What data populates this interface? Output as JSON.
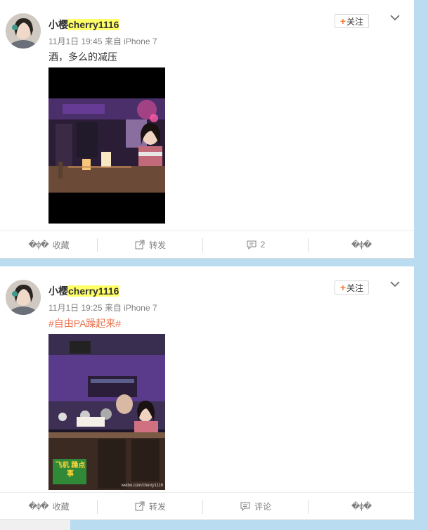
{
  "posts": [
    {
      "user": {
        "name_prefix": "小樱",
        "name_highlight": "cherry1116"
      },
      "meta": "11月1日 19:45 来自 iPhone 7",
      "text": "酒，多么的减压",
      "follow_label": "关注",
      "follow_plus": "+",
      "actions": {
        "fav_glyphs": "�ϕ�",
        "fav_label": "收藏",
        "repost_label": "转发",
        "comment_label": "2",
        "like_glyphs": "�ϕ�"
      }
    },
    {
      "user": {
        "name_prefix": "小樱",
        "name_highlight": "cherry1116"
      },
      "meta": "11月1日 19:25 来自 iPhone 7",
      "text": "#自由PA躁起来#",
      "follow_label": "关注",
      "follow_plus": "+",
      "photo_watermark": "飞机 躁点事",
      "photo_credit": "weibo.com/cherry1116",
      "actions": {
        "fav_glyphs": "�ϕ�",
        "fav_label": "收藏",
        "repost_label": "转发",
        "comment_label": "评论",
        "like_glyphs": "�ϕ�"
      }
    }
  ],
  "colors": {
    "accent": "#fa7d3c",
    "topic": "#eb7350",
    "highlight": "#ffff66",
    "background": "#b9dcf0"
  }
}
